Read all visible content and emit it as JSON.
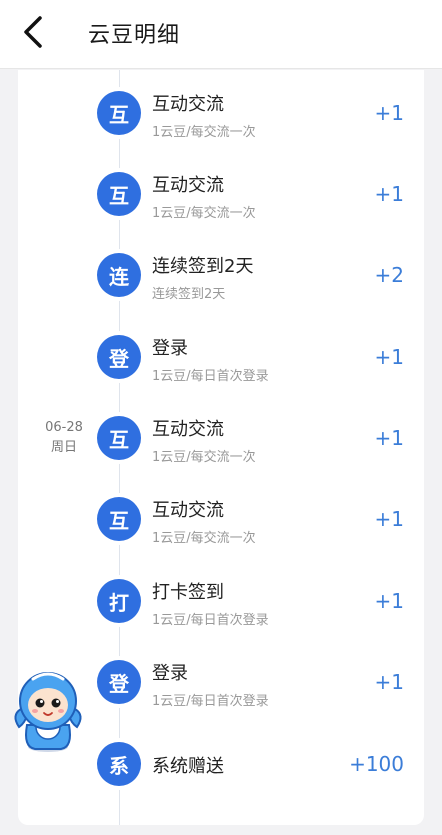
{
  "header": {
    "title": "云豆明细"
  },
  "date": {
    "day": "06-28",
    "weekday": "周日"
  },
  "records": [
    {
      "badge": "互",
      "title": "互动交流",
      "subtitle": "1云豆/每交流一次",
      "value": "+1"
    },
    {
      "badge": "互",
      "title": "互动交流",
      "subtitle": "1云豆/每交流一次",
      "value": "+1"
    },
    {
      "badge": "连",
      "title": "连续签到2天",
      "subtitle": "连续签到2天",
      "value": "+2"
    },
    {
      "badge": "登",
      "title": "登录",
      "subtitle": "1云豆/每日首次登录",
      "value": "+1"
    },
    {
      "badge": "互",
      "title": "互动交流",
      "subtitle": "1云豆/每交流一次",
      "value": "+1"
    },
    {
      "badge": "互",
      "title": "互动交流",
      "subtitle": "1云豆/每交流一次",
      "value": "+1"
    },
    {
      "badge": "打",
      "title": "打卡签到",
      "subtitle": "1云豆/每日首次登录",
      "value": "+1"
    },
    {
      "badge": "登",
      "title": "登录",
      "subtitle": "1云豆/每日首次登录",
      "value": "+1"
    },
    {
      "badge": "系",
      "title": "系统赠送",
      "subtitle": "",
      "value": "+100"
    }
  ],
  "colors": {
    "accent": "#2f6fe0",
    "value": "#3b7dd8"
  },
  "icons": {
    "back": "chevron-left-icon",
    "mascot": "mascot-icon"
  }
}
